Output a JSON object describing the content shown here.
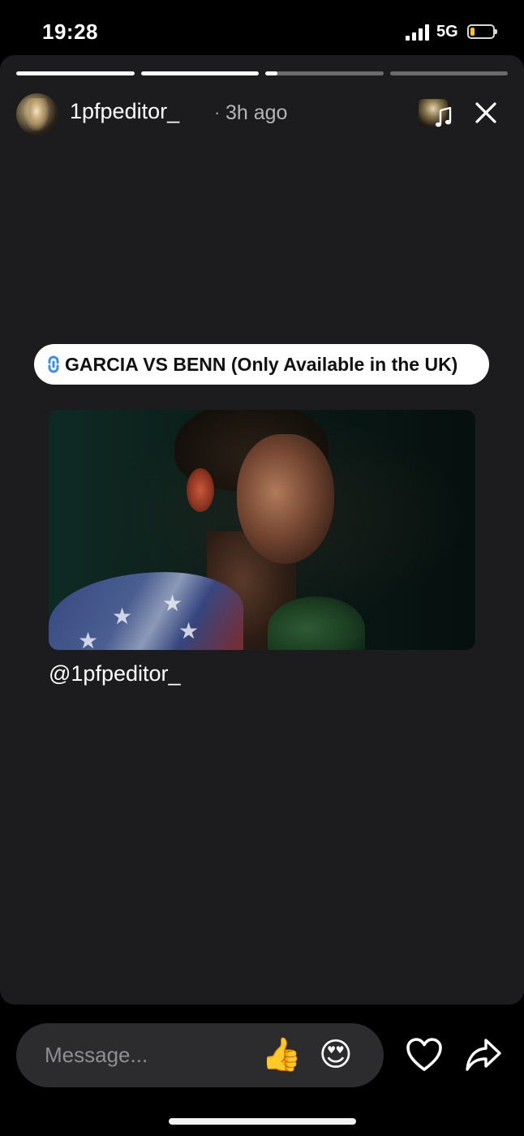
{
  "status_bar": {
    "time": "19:28",
    "network": "5G",
    "battery_level": 0.2,
    "battery_color": "#f5c518"
  },
  "story": {
    "background": "#1c1c1e",
    "progress": [
      1.0,
      1.0,
      0.1,
      0.0
    ],
    "author": "1pfpeditor_",
    "separator": "·",
    "time_ago": "3h ago",
    "music_icon": "music-note-icon",
    "close_icon": "close-icon",
    "link_sticker": {
      "icon": "link-icon",
      "label": "GARCIA VS BENN (Only Available in the UK)",
      "icon_color": "#3b8ef0"
    },
    "mention": "@1pfpeditor_"
  },
  "reply_bar": {
    "placeholder": "Message...",
    "quick_reactions": [
      "👍",
      "😍"
    ],
    "like_icon": "heart-icon",
    "share_icon": "share-arrow-icon"
  }
}
